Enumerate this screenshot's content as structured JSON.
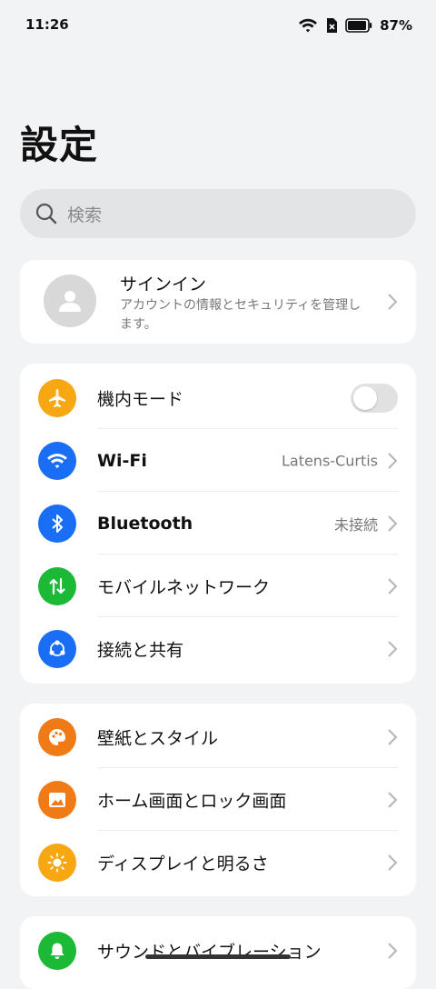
{
  "status_bar": {
    "time": "11:26",
    "battery_percent": "87%"
  },
  "page_title": "設定",
  "search": {
    "placeholder": "検索"
  },
  "account": {
    "title": "サインイン",
    "subtitle": "アカウントの情報とセキュリティを管理します。"
  },
  "group1": {
    "airplane": {
      "label": "機内モード",
      "icon": "airplane-icon",
      "color": "#f6a712",
      "enabled": false
    },
    "wifi": {
      "label": "Wi-Fi",
      "value": "Latens-Curtis",
      "icon": "wifi-icon",
      "color": "#1a6ef5"
    },
    "bluetooth": {
      "label": "Bluetooth",
      "value": "未接続",
      "icon": "bluetooth-icon",
      "color": "#1a6ef5"
    },
    "mobile": {
      "label": "モバイルネットワーク",
      "icon": "mobile-data-icon",
      "color": "#1bb935"
    },
    "connection": {
      "label": "接続と共有",
      "icon": "share-icon",
      "color": "#1a6ef5"
    }
  },
  "group2": {
    "wallpaper": {
      "label": "壁紙とスタイル",
      "icon": "palette-icon",
      "color": "#f07a16"
    },
    "homescreen": {
      "label": "ホーム画面とロック画面",
      "icon": "image-icon",
      "color": "#f07a16"
    },
    "display": {
      "label": "ディスプレイと明るさ",
      "icon": "sun-icon",
      "color": "#f6a712"
    }
  },
  "group3": {
    "sound": {
      "label": "サウンドとバイブレーション",
      "icon": "bell-icon",
      "color": "#1bb935"
    }
  }
}
